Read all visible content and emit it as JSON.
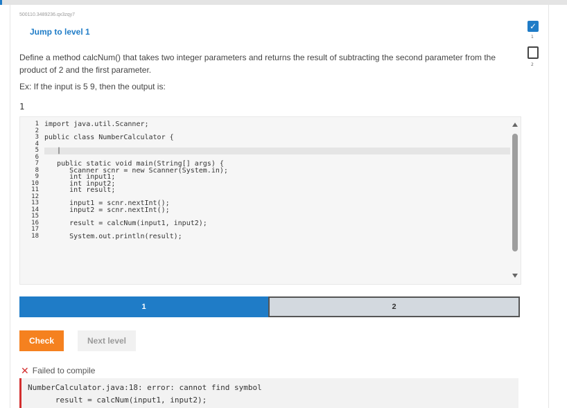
{
  "question_id": "500110.3489236.qx3zqy7",
  "jump_link": "Jump to level 1",
  "prompt": "Define a method calcNum() that takes two integer parameters and returns the result of subtracting the second parameter from the product of 2 and the first parameter.",
  "example": "Ex: If the input is 5 9, then the output is:",
  "sample_output": "1",
  "code": {
    "line_numbers": [
      "1",
      "2",
      "3",
      "4",
      "5",
      "6",
      "7",
      "8",
      "9",
      "10",
      "11",
      "12",
      "13",
      "14",
      "15",
      "16",
      "17",
      "18"
    ],
    "lines": [
      "import java.util.Scanner;",
      "",
      "public class NumberCalculator {",
      "",
      "   |",
      "",
      "   public static void main(String[] args) {",
      "      Scanner scnr = new Scanner(System.in);",
      "      int input1;",
      "      int input2;",
      "      int result;",
      "",
      "      input1 = scnr.nextInt();",
      "      input2 = scnr.nextInt();",
      "",
      "      result = calcNum(input1, input2);",
      "",
      "      System.out.println(result);"
    ]
  },
  "levels": [
    {
      "label": "1",
      "state": "current"
    },
    {
      "label": "2",
      "state": "upcoming"
    }
  ],
  "buttons": {
    "check": "Check",
    "next": "Next level"
  },
  "feedback": {
    "status": "Failed to compile",
    "error_lines": [
      "NumberCalculator.java:18: error: cannot find symbol",
      "      result = calcNum(input1, input2);"
    ]
  },
  "side_tools": {
    "check_icon": "check-icon",
    "n1": "1",
    "n2": "2"
  },
  "colors": {
    "accent": "#1f7cc7",
    "check": "#f5811f",
    "error": "#d32f2f"
  }
}
